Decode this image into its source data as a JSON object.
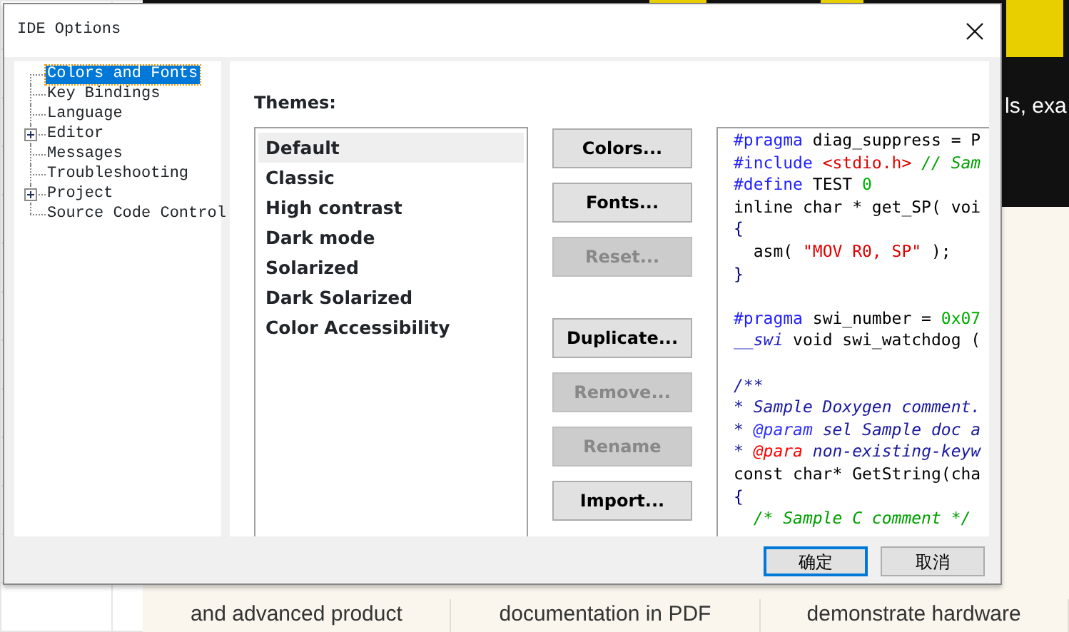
{
  "background": {
    "banner_text": "ls, exa",
    "cards": [
      {
        "lines": [
          "and advanced product"
        ]
      },
      {
        "lines": [
          "documentation in PDF"
        ]
      },
      {
        "lines": [
          "demonstrate hardware"
        ]
      }
    ]
  },
  "window": {
    "title": "IDE Options"
  },
  "tree": [
    {
      "label": "Colors and Fonts",
      "selected": true,
      "expandable": false
    },
    {
      "label": "Key Bindings",
      "selected": false,
      "expandable": false
    },
    {
      "label": "Language",
      "selected": false,
      "expandable": false
    },
    {
      "label": "Editor",
      "selected": false,
      "expandable": true
    },
    {
      "label": "Messages",
      "selected": false,
      "expandable": false
    },
    {
      "label": "Troubleshooting",
      "selected": false,
      "expandable": false
    },
    {
      "label": "Project",
      "selected": false,
      "expandable": true
    },
    {
      "label": "Source Code Control",
      "selected": false,
      "expandable": false
    }
  ],
  "themes_label": "Themes:",
  "themes": [
    {
      "label": "Default",
      "selected": true
    },
    {
      "label": "Classic",
      "selected": false
    },
    {
      "label": "High contrast",
      "selected": false
    },
    {
      "label": "Dark mode",
      "selected": false
    },
    {
      "label": "Solarized",
      "selected": false
    },
    {
      "label": "Dark Solarized",
      "selected": false
    },
    {
      "label": "Color Accessibility",
      "selected": false
    }
  ],
  "buttons": [
    {
      "kind": "button",
      "label": "Colors...",
      "disabled": false
    },
    {
      "kind": "button",
      "label": "Fonts...",
      "disabled": false
    },
    {
      "kind": "button",
      "label": "Reset...",
      "disabled": true
    },
    {
      "kind": "spacer"
    },
    {
      "kind": "button",
      "label": "Duplicate...",
      "disabled": false
    },
    {
      "kind": "button",
      "label": "Remove...",
      "disabled": true
    },
    {
      "kind": "button",
      "label": "Rename",
      "disabled": true
    },
    {
      "kind": "button",
      "label": "Import...",
      "disabled": false
    }
  ],
  "preview": [
    {
      "kind": "code",
      "tokens": [
        {
          "kind": "keyword",
          "text": "#pragma"
        },
        {
          "kind": "plain",
          "text": " diag_suppress = P"
        }
      ]
    },
    {
      "kind": "code",
      "tokens": [
        {
          "kind": "keyword",
          "text": "#include"
        },
        {
          "kind": "string",
          "text": " <stdio.h>"
        },
        {
          "kind": "comment",
          "text": " // Sam"
        }
      ]
    },
    {
      "kind": "code",
      "tokens": [
        {
          "kind": "keyword",
          "text": "#define"
        },
        {
          "kind": "plain",
          "text": " TEST "
        },
        {
          "kind": "number",
          "text": "0"
        }
      ]
    },
    {
      "kind": "code",
      "tokens": [
        {
          "kind": "plain",
          "text": "inline char * get_SP( voi"
        }
      ]
    },
    {
      "kind": "code",
      "tokens": [
        {
          "kind": "brace",
          "text": "{"
        }
      ]
    },
    {
      "kind": "code",
      "tokens": [
        {
          "kind": "plain",
          "text": "  asm( "
        },
        {
          "kind": "string",
          "text": "\"MOV R0, SP\""
        },
        {
          "kind": "plain",
          "text": " );"
        }
      ]
    },
    {
      "kind": "code",
      "tokens": [
        {
          "kind": "brace",
          "text": "}"
        }
      ]
    },
    {
      "kind": "blank"
    },
    {
      "kind": "code",
      "tokens": [
        {
          "kind": "keyword",
          "text": "#pragma"
        },
        {
          "kind": "plain",
          "text": " swi_number = "
        },
        {
          "kind": "number",
          "text": "0x07"
        }
      ]
    },
    {
      "kind": "code",
      "tokens": [
        {
          "kind": "extension",
          "text": "__swi"
        },
        {
          "kind": "plain",
          "text": " void swi_watchdog ("
        }
      ]
    },
    {
      "kind": "blank"
    },
    {
      "kind": "code",
      "tokens": [
        {
          "kind": "doc",
          "text": "/**"
        }
      ]
    },
    {
      "kind": "code",
      "tokens": [
        {
          "kind": "doc",
          "text": "* Sample Doxygen comment."
        }
      ]
    },
    {
      "kind": "code",
      "tokens": [
        {
          "kind": "doc",
          "text": "* "
        },
        {
          "kind": "doc_tag",
          "text": "@param"
        },
        {
          "kind": "doc",
          "text": " sel Sample doc a"
        }
      ]
    },
    {
      "kind": "code",
      "tokens": [
        {
          "kind": "doc",
          "text": "* "
        },
        {
          "kind": "error",
          "text": "@para"
        },
        {
          "kind": "doc",
          "text": " non-existing-keyw"
        }
      ]
    },
    {
      "kind": "code",
      "tokens": [
        {
          "kind": "plain",
          "text": "const char* GetString(cha"
        }
      ]
    },
    {
      "kind": "code",
      "tokens": [
        {
          "kind": "brace",
          "text": "{"
        }
      ]
    },
    {
      "kind": "code",
      "tokens": [
        {
          "kind": "comment",
          "text": "  /* Sample C comment */"
        }
      ]
    }
  ],
  "footer_buttons": [
    {
      "label": "确定",
      "default": true
    },
    {
      "label": "取消",
      "default": false
    }
  ]
}
